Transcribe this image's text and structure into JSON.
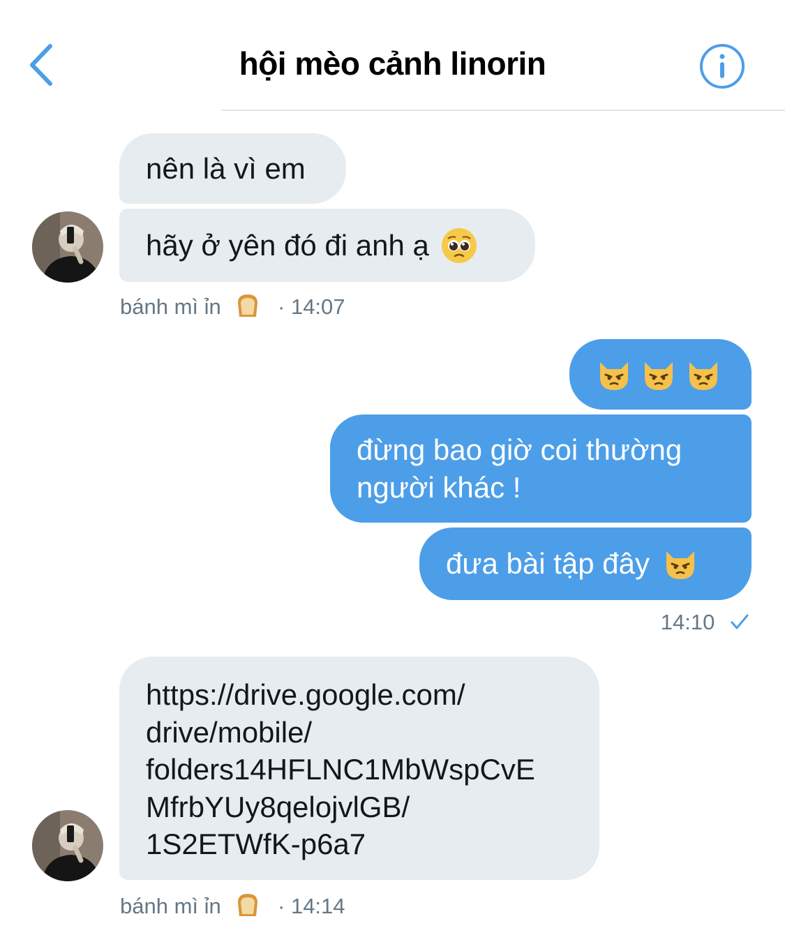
{
  "header": {
    "title": "hội mèo cảnh linorin",
    "back_icon": "chevron-left-icon",
    "info_icon": "info-circle-icon",
    "accent": "#4d9ee8"
  },
  "messages": [
    {
      "from": "other",
      "text": "nên là vì em"
    },
    {
      "from": "other",
      "text": "hãy ở yên đó đi anh ạ",
      "emoji": "pleading-face"
    },
    {
      "from": "me",
      "emoji": "pouting-cat x3"
    },
    {
      "from": "me",
      "text_line1": "đừng bao giờ coi thường",
      "text_line2": "người khác !"
    },
    {
      "from": "me",
      "text": "đưa bài tập đây",
      "emoji": "pouting-cat"
    },
    {
      "from": "other",
      "lines": [
        "https://drive.google.com/",
        "drive/mobile/",
        "folders14HFLNC1MbWspCvE",
        "MfrbYUy8qelojvlGB/",
        "1S2ETWfK-p6a7"
      ]
    }
  ],
  "meta": {
    "group1": {
      "sender": "bánh mì ỉn",
      "sender_emoji": "bread",
      "time": "· 14:07"
    },
    "mine": {
      "time": "14:10",
      "status_icon": "check-icon"
    },
    "group2": {
      "sender": "bánh mì ỉn",
      "sender_emoji": "bread",
      "time": "· 14:14"
    }
  },
  "colors": {
    "incoming_bubble": "#e6ecf0",
    "outgoing_bubble": "#4d9ee8",
    "meta_text": "#657786"
  }
}
